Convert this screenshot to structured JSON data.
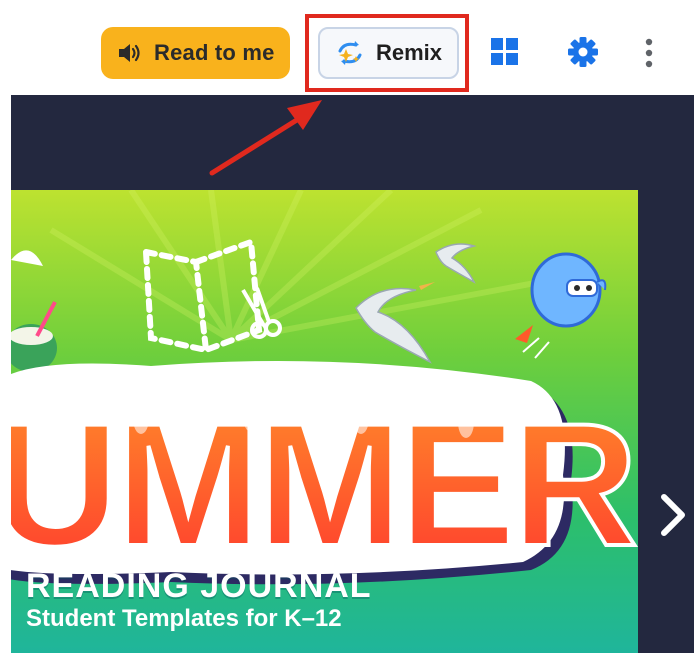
{
  "toolbar": {
    "read_to_me_label": "Read to me",
    "remix_label": "Remix",
    "icons": {
      "speaker": "speaker-icon",
      "remix": "remix-sparkle-icon",
      "grid": "grid-icon",
      "settings": "gear-icon",
      "more": "more-vertical-icon"
    }
  },
  "cover": {
    "title_word": "UMMER",
    "subtitle": "READING JOURNAL",
    "tagline": "Student Templates for K–12"
  },
  "viewer": {
    "next_icon": "chevron-right-icon"
  },
  "colors": {
    "read_button": "#f9b21c",
    "accent_blue": "#1a73e8",
    "highlight_red": "#e0291e",
    "viewer_bg": "#23283f"
  }
}
